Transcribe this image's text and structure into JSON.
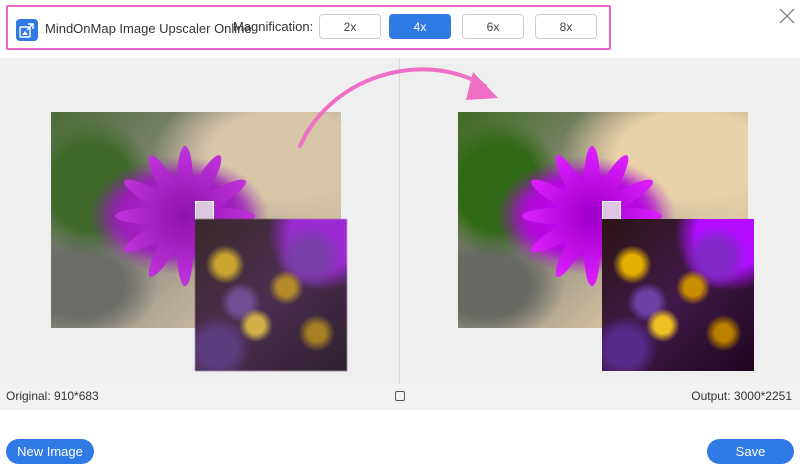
{
  "header": {
    "app_title": "MindOnMap Image Upscaler Online",
    "magnification_label": "Magnification:",
    "magnification_options": [
      "2x",
      "4x",
      "6x",
      "8x"
    ],
    "selected_magnification": "4x"
  },
  "info": {
    "original": "Original: 910*683",
    "output": "Output: 3000*2251"
  },
  "actions": {
    "new_image": "New Image",
    "save": "Save"
  },
  "colors": {
    "accent": "#2f7ae5",
    "highlight": "#e866c9",
    "arrow": "#ef6fc4"
  }
}
